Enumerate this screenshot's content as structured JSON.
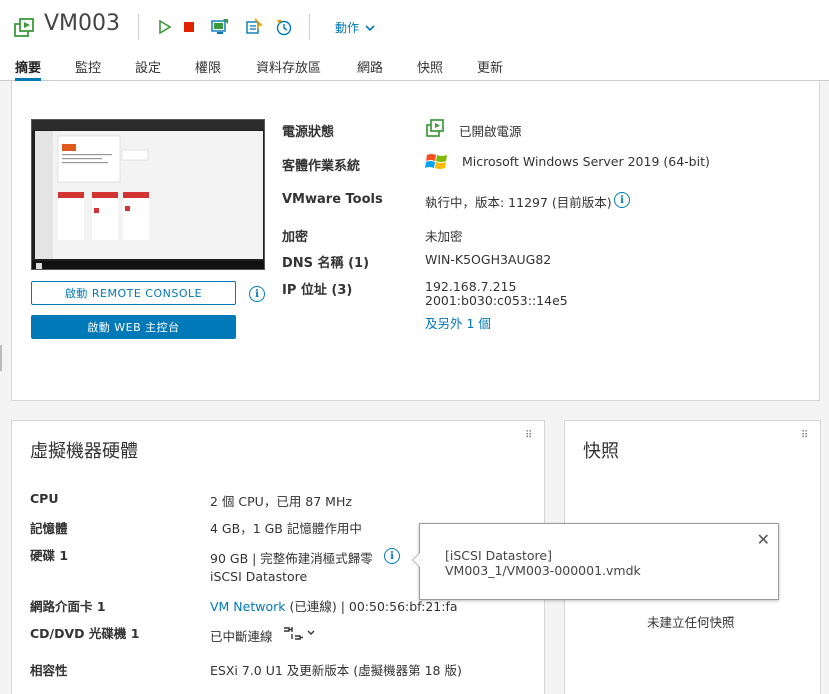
{
  "header": {
    "title": "VM003",
    "actions_label": "動作",
    "toolbar_icons": [
      "vm-icon",
      "power-on-icon",
      "power-off-icon",
      "console-icon",
      "migrate-icon",
      "snapshot-icon"
    ]
  },
  "tabs": [
    {
      "label": "摘要",
      "active": true
    },
    {
      "label": "監控",
      "active": false
    },
    {
      "label": "設定",
      "active": false
    },
    {
      "label": "權限",
      "active": false
    },
    {
      "label": "資料存放區",
      "active": false
    },
    {
      "label": "網路",
      "active": false
    },
    {
      "label": "快照",
      "active": false
    },
    {
      "label": "更新",
      "active": false
    }
  ],
  "summary": {
    "remote_console_label": "啟動 REMOTE CONSOLE",
    "web_console_label": "啟動 WEB 主控台",
    "props": {
      "power_label": "電源狀態",
      "power_value": "已開啟電源",
      "os_label": "客體作業系統",
      "os_value": "Microsoft Windows Server 2019 (64-bit)",
      "tools_label": "VMware Tools",
      "tools_value": "執行中，版本: 11297 (目前版本)",
      "encryption_label": "加密",
      "encryption_value": "未加密",
      "dns_label": "DNS 名稱 (1)",
      "dns_value": "WIN-K5OGH3AUG82",
      "ip_label": "IP 位址 (3)",
      "ip_value_1": "192.168.7.215",
      "ip_value_2": "2001:b030:c053::14e5",
      "ip_more_link": "及另外 1 個"
    }
  },
  "hardware": {
    "title": "虛擬機器硬體",
    "cpu_label": "CPU",
    "cpu_value": "2 個 CPU，已用 87 MHz",
    "memory_label": "記憶體",
    "memory_value": "4 GB，1 GB 記憶體作用中",
    "disk_label": "硬碟 1",
    "disk_value": "90 GB | 完整佈建消極式歸零",
    "disk_link": "iSCSI Datastore",
    "nic_label": "網路介面卡 1",
    "nic_link": "VM Network",
    "nic_value": " (已連線) | 00:50:56:bf:21:fa",
    "cd_label": "CD/DVD 光碟機 1",
    "cd_value": "已中斷連線",
    "compat_label": "相容性",
    "compat_value": "ESXi 7.0 U1 及更新版本 (虛擬機器第 18 版)"
  },
  "snapshots": {
    "title": "快照",
    "empty_text": "未建立任何快照"
  },
  "tooltip": {
    "line1": "[iSCSI Datastore]",
    "line2": "VM003_1/VM003-000001.vmdk"
  },
  "colors": {
    "accent": "#0079b8",
    "power_on": "#3c9a3c",
    "power_off": "#e12200"
  }
}
